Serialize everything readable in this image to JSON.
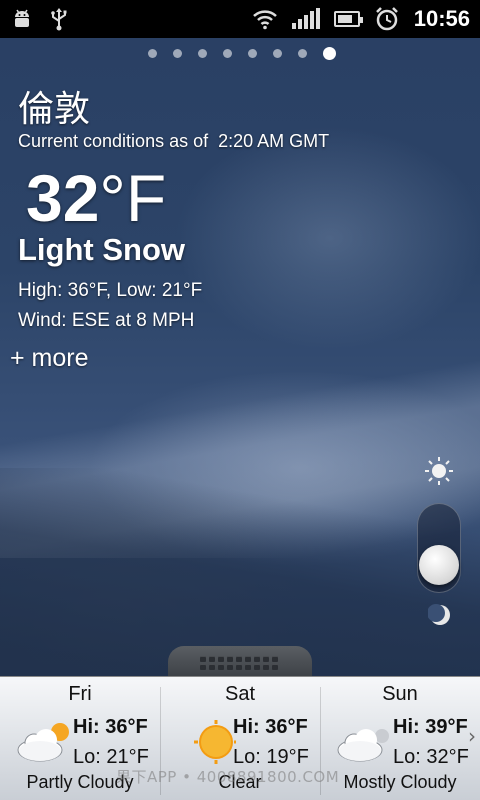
{
  "status_bar": {
    "time": "10:56",
    "battery_level": 0.8,
    "icons_left": [
      "android-debug-icon",
      "usb-icon"
    ],
    "icons_right": [
      "wifi-icon",
      "signal-icon",
      "battery-icon",
      "alarm-icon"
    ]
  },
  "pager": {
    "count": 8,
    "active_index": 7
  },
  "current": {
    "city": "倫敦",
    "as_of": "Current conditions as of  2:20 AM GMT",
    "temp_value": "32",
    "temp_unit": "°F",
    "condition": "Light Snow",
    "high_low": "High: 36°F, Low: 21°F",
    "wind": "Wind: ESE at 8 MPH",
    "more_label": "+ more"
  },
  "brightness": {
    "level": 0.4
  },
  "forecast": [
    {
      "day": "Fri",
      "hi_label": "Hi:",
      "hi": "36°F",
      "lo": "Lo: 21°F",
      "condition": "Partly Cloudy",
      "icon": "partly-cloudy-icon"
    },
    {
      "day": "Sat",
      "hi_label": "Hi:",
      "hi": "36°F",
      "lo": "Lo: 19°F",
      "condition": "Clear",
      "icon": "sun-icon"
    },
    {
      "day": "Sun",
      "hi_label": "Hi:",
      "hi": "39°F",
      "lo": "Lo: 32°F",
      "condition": "Mostly Cloudy",
      "icon": "mostly-cloudy-icon"
    }
  ],
  "watermark": "果下APP • 4008891800.COM"
}
